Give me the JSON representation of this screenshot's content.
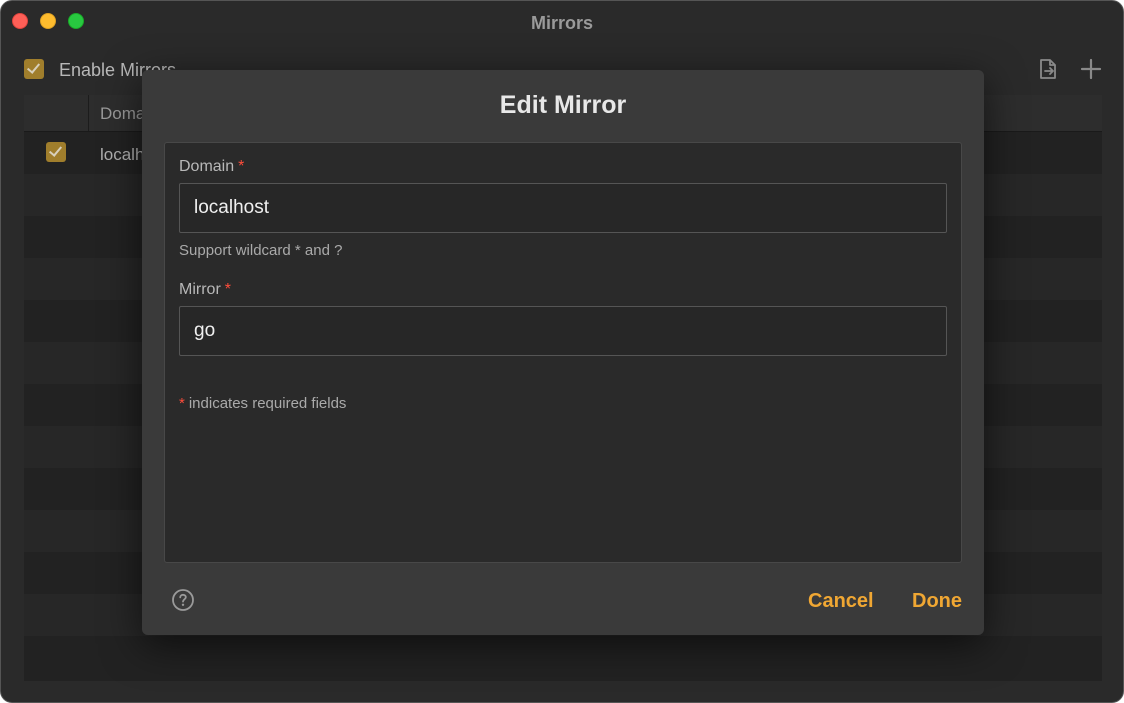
{
  "window": {
    "title": "Mirrors"
  },
  "toolbar": {
    "enable_label": "Enable Mirrors",
    "enable_checked": true,
    "import_icon": "document-import-icon",
    "add_icon": "plus-icon"
  },
  "table": {
    "columns": [
      "Domain"
    ],
    "rows": [
      {
        "enabled": true,
        "domain": "localhost"
      }
    ]
  },
  "dialog": {
    "title": "Edit Mirror",
    "domain_label": "Domain",
    "domain_value": "localhost",
    "domain_hint": "Support wildcard * and ?",
    "mirror_label": "Mirror",
    "mirror_value": "go",
    "required_marker": "*",
    "required_note": "indicates required fields",
    "cancel_label": "Cancel",
    "done_label": "Done",
    "help_icon": "question-circle-icon"
  },
  "colors": {
    "accent": "#f0a733",
    "required": "#ff4d3b",
    "checkbox": "#a07e2c"
  }
}
